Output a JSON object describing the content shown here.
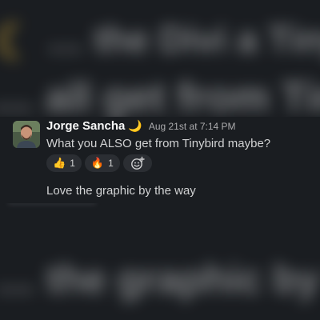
{
  "message": {
    "author": "Jorge Sancha",
    "author_emoji": "🌙",
    "timestamp": "Aug 21st at 7:14 PM",
    "text": "What you ALSO get from Tinybird maybe?",
    "reactions": [
      {
        "emoji": "👍",
        "count": "1"
      },
      {
        "emoji": "🔥",
        "count": "1"
      }
    ],
    "add_reaction_icon": "add-emoji-icon",
    "follow_up_text": "Love the graphic by the way"
  },
  "background": {
    "top_text": "… the Divi a Tiny",
    "mid_text": "… all get from Tinybi",
    "bottom_text": "… the graphic by the way"
  },
  "colors": {
    "background": "#1a1d21",
    "text": "#d1d2d3",
    "author": "#f8f8f8",
    "muted": "#ababad",
    "reaction_bg": "#2b2e33"
  }
}
